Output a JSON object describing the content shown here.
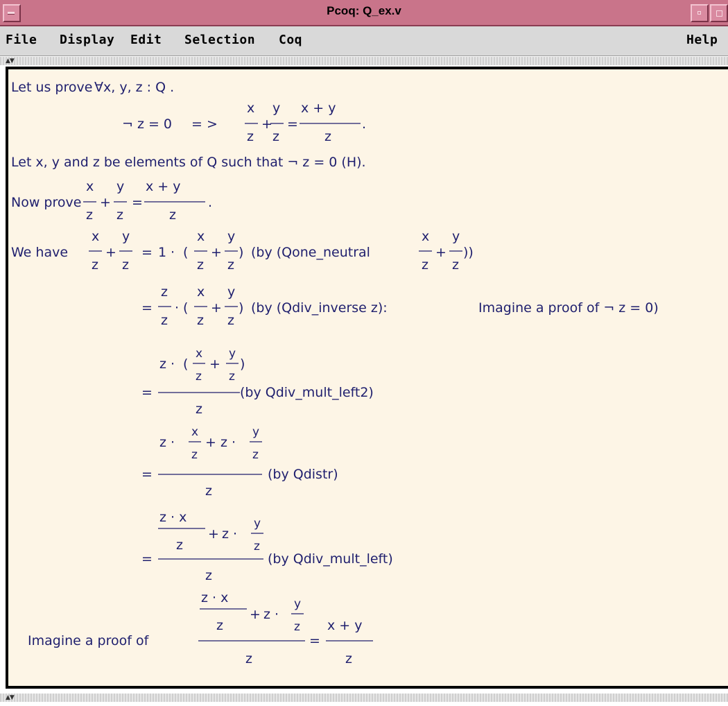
{
  "window": {
    "title": "Pcoq: Q_ex.v"
  },
  "menubar": {
    "items": [
      {
        "label": "File"
      },
      {
        "label": "Display"
      },
      {
        "label": "Edit"
      },
      {
        "label": "Selection"
      },
      {
        "label": "Coq"
      }
    ],
    "help_label": "Help"
  },
  "colors": {
    "title_bar": "#c9748a",
    "panel_bg": "#fdf5e6",
    "text": "#1f1f6e"
  },
  "proof": {
    "statement": {
      "lead": "Let us prove",
      "quantified": "∀x,  y,  z : Q .",
      "hypothesis": "¬ z  =  0",
      "implies": "= >"
    },
    "intro": "Let   x, y and z be  elements of Q  such that  ¬ z  =  0 (H).",
    "goal_lead": "Now prove",
    "we_have": "We have",
    "steps": [
      {
        "justification": "(by (Qone_neutral",
        "justification_end": "))"
      },
      {
        "justification": "(by (Qdiv_inverse  z):",
        "extra": "Imagine a proof of ¬ z  =  0)"
      },
      {
        "justification": "(by Qdiv_mult_left2)"
      },
      {
        "justification": "(by Qdistr)"
      },
      {
        "justification": "(by Qdiv_mult_left)"
      }
    ],
    "final_lead": "Imagine a proof of",
    "symbols": {
      "x": "x",
      "y": "y",
      "z": "z",
      "one": "1",
      "plus": "+",
      "eq": "=",
      "dot": "·",
      "x_plus_y": "x + y",
      "z_dot_x": "z · x",
      "z_dot": "z ·",
      "lparen": "(",
      "rparen": ")",
      "period": "."
    }
  }
}
